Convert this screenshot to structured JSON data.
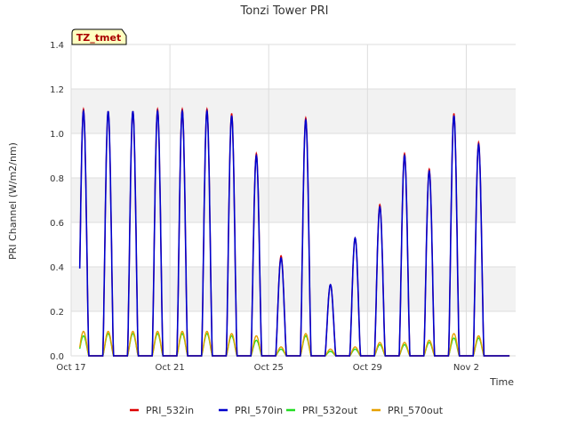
{
  "chart_data": {
    "type": "line",
    "title": "Tonzi Tower PRI",
    "xlabel": "Time",
    "ylabel": "PRI Channel (W/m2/nm)",
    "ylim": [
      0,
      1.4
    ],
    "yticks": [
      "0.0",
      "0.2",
      "0.4",
      "0.6",
      "0.8",
      "1.0",
      "1.2",
      "1.4"
    ],
    "x_range_days": [
      0,
      18
    ],
    "xticks": [
      {
        "label": "Oct 17",
        "day": 0
      },
      {
        "label": "Oct 21",
        "day": 4
      },
      {
        "label": "Oct 25",
        "day": 8
      },
      {
        "label": "Oct 29",
        "day": 12
      },
      {
        "label": "Nov 2",
        "day": 16
      }
    ],
    "grid": true,
    "legend_position": "bottom",
    "annotation": "TZ_tmet",
    "series": [
      {
        "name": "PRI_532in",
        "color": "#dd0000"
      },
      {
        "name": "PRI_570in",
        "color": "#0000cc"
      },
      {
        "name": "PRI_532out",
        "color": "#22dd22"
      },
      {
        "name": "PRI_570out",
        "color": "#e6a000"
      }
    ],
    "daily_peaks": [
      {
        "date": "Oct 17",
        "in532": 1.11,
        "in570": 1.1,
        "out532": 0.09,
        "out570": 0.11
      },
      {
        "date": "Oct 18",
        "in532": 1.1,
        "in570": 1.1,
        "out532": 0.1,
        "out570": 0.11
      },
      {
        "date": "Oct 19",
        "in532": 1.1,
        "in570": 1.1,
        "out532": 0.1,
        "out570": 0.11
      },
      {
        "date": "Oct 20",
        "in532": 1.11,
        "in570": 1.1,
        "out532": 0.1,
        "out570": 0.11
      },
      {
        "date": "Oct 21",
        "in532": 1.11,
        "in570": 1.1,
        "out532": 0.1,
        "out570": 0.11
      },
      {
        "date": "Oct 22",
        "in532": 1.11,
        "in570": 1.1,
        "out532": 0.1,
        "out570": 0.11
      },
      {
        "date": "Oct 23",
        "in532": 1.09,
        "in570": 1.08,
        "out532": 0.09,
        "out570": 0.1
      },
      {
        "date": "Oct 24",
        "in532": 0.91,
        "in570": 0.9,
        "out532": 0.07,
        "out570": 0.09
      },
      {
        "date": "Oct 25",
        "in532": 0.45,
        "in570": 0.44,
        "out532": 0.03,
        "out570": 0.04
      },
      {
        "date": "Oct 26",
        "in532": 1.07,
        "in570": 1.06,
        "out532": 0.09,
        "out570": 0.1
      },
      {
        "date": "Oct 27",
        "in532": 0.32,
        "in570": 0.32,
        "out532": 0.02,
        "out570": 0.03
      },
      {
        "date": "Oct 28",
        "in532": 0.53,
        "in570": 0.53,
        "out532": 0.03,
        "out570": 0.04
      },
      {
        "date": "Oct 29",
        "in532": 0.68,
        "in570": 0.67,
        "out532": 0.05,
        "out570": 0.06
      },
      {
        "date": "Oct 30",
        "in532": 0.91,
        "in570": 0.9,
        "out532": 0.05,
        "out570": 0.06
      },
      {
        "date": "Oct 31",
        "in532": 0.84,
        "in570": 0.83,
        "out532": 0.06,
        "out570": 0.07
      },
      {
        "date": "Nov 1",
        "in532": 1.09,
        "in570": 1.08,
        "out532": 0.08,
        "out570": 0.1
      },
      {
        "date": "Nov 2",
        "in532": 0.96,
        "in570": 0.95,
        "out532": 0.08,
        "out570": 0.09
      }
    ]
  }
}
